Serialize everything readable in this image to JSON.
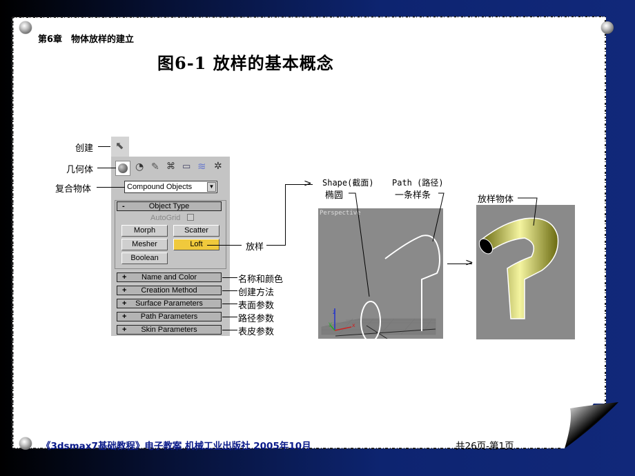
{
  "slide": {
    "chapter": "第6章　物体放样的建立",
    "title": "图6-1 放样的基本概念",
    "footer_left": "《3dsmax7基础教程》电子教案 机械工业出版社 2005年10月",
    "footer_right": "共26页-第1页",
    "colors": {
      "background": "#0d2470",
      "paper": "#ffffff",
      "footer_text": "#0a1a8a",
      "loft_highlight": "#f0c93c"
    }
  },
  "callouts": {
    "create": "创建",
    "geometry": "几何体",
    "compound": "复合物体",
    "loft": "放样",
    "name_color": "名称和颜色",
    "creation_method": "创建方法",
    "surface_params": "表面参数",
    "path_params": "路径参数",
    "skin_params": "表皮参数",
    "shape": "Shape(截面)",
    "ellipse": "椭圆",
    "path": "Path (路径)",
    "spline": "一条样条",
    "loft_object": "放样物体"
  },
  "panel": {
    "dropdown_value": "Compound Objects",
    "object_type_header": "Object Type",
    "object_type_sign": "-",
    "autogrid_label": "AutoGrid",
    "buttons": [
      "Morph",
      "Scatter",
      "Mesher",
      "Loft",
      "Boolean"
    ],
    "rollouts": [
      {
        "sign": "+",
        "label": "Name and Color"
      },
      {
        "sign": "+",
        "label": "Creation Method"
      },
      {
        "sign": "+",
        "label": "Surface Parameters"
      },
      {
        "sign": "+",
        "label": "Path Parameters"
      },
      {
        "sign": "+",
        "label": "Skin Parameters"
      }
    ],
    "toolbar_icons": [
      "geometry-sphere-icon",
      "shapes-icon",
      "lights-icon",
      "cameras-icon",
      "helpers-icon",
      "spacewarps-icon",
      "systems-icon"
    ]
  },
  "viewport": {
    "label": "Perspective",
    "axes": {
      "x": "x",
      "y": "y",
      "z": "z"
    }
  }
}
